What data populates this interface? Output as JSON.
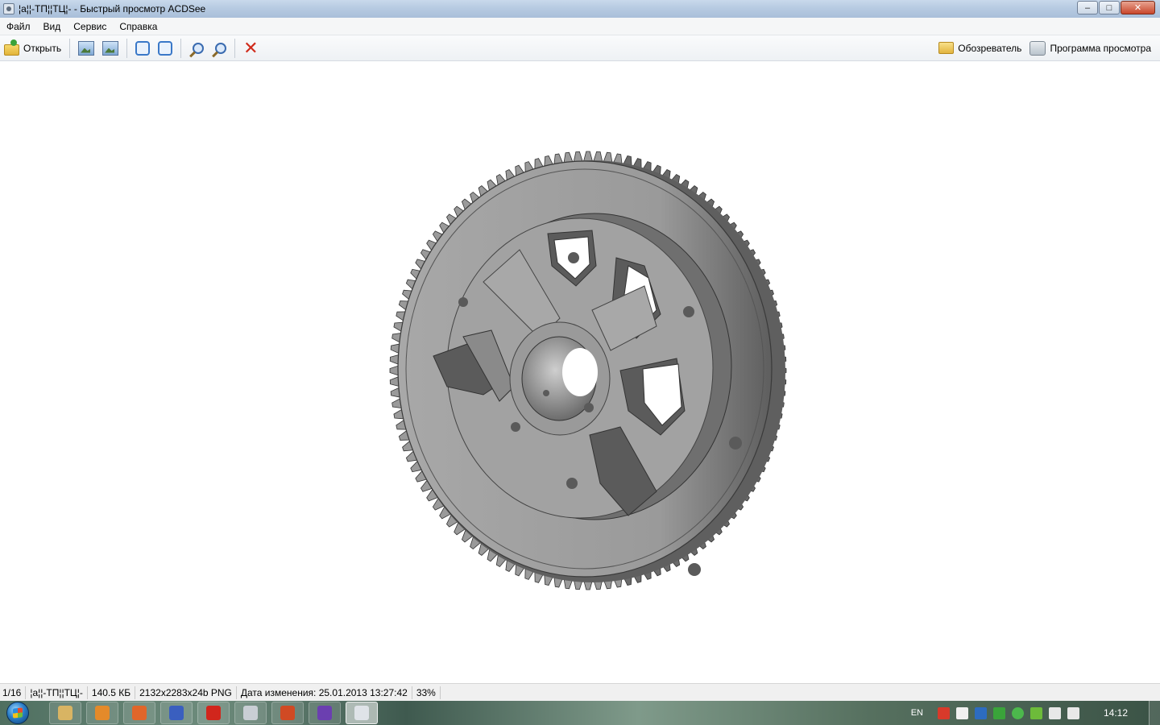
{
  "window": {
    "title": "¦а¦¦-ТП¦¦ТЦ¦- - Быстрый просмотр ACDSee",
    "controls": {
      "minimize": "–",
      "maximize": "□",
      "close": "✕"
    }
  },
  "menu": [
    "Файл",
    "Вид",
    "Сервис",
    "Справка"
  ],
  "toolbar": {
    "open_label": "Открыть",
    "explorer_label": "Обозреватель",
    "viewer_label": "Программа просмотра",
    "delete_glyph": "✕"
  },
  "statusbar": {
    "position": "1/16",
    "filename": "¦а¦¦-ТП¦¦ТЦ¦-",
    "filesize": "140.5 КБ",
    "dimensions": "2132x2283x24b PNG",
    "modified": "Дата изменения: 25.01.2013 13:27:42",
    "zoom": "33%"
  },
  "taskbar": {
    "apps": [
      {
        "name": "explorer",
        "color": "#d8b463"
      },
      {
        "name": "media-player",
        "color": "#e48a2a"
      },
      {
        "name": "firefox",
        "color": "#e0662a"
      },
      {
        "name": "save-app",
        "color": "#3a5fbf"
      },
      {
        "name": "opera",
        "color": "#d1261c"
      },
      {
        "name": "calculator",
        "color": "#c9ced4"
      },
      {
        "name": "powerpoint",
        "color": "#d04a24"
      },
      {
        "name": "visual-studio",
        "color": "#6b3fb0"
      },
      {
        "name": "acdsee",
        "color": "#dfe3e8",
        "active": true
      }
    ],
    "tray": {
      "language": "EN",
      "clock": "14:12"
    }
  },
  "image": {
    "subject": "gear",
    "fill_color": "#9a9a9a",
    "teeth_count": 120
  }
}
